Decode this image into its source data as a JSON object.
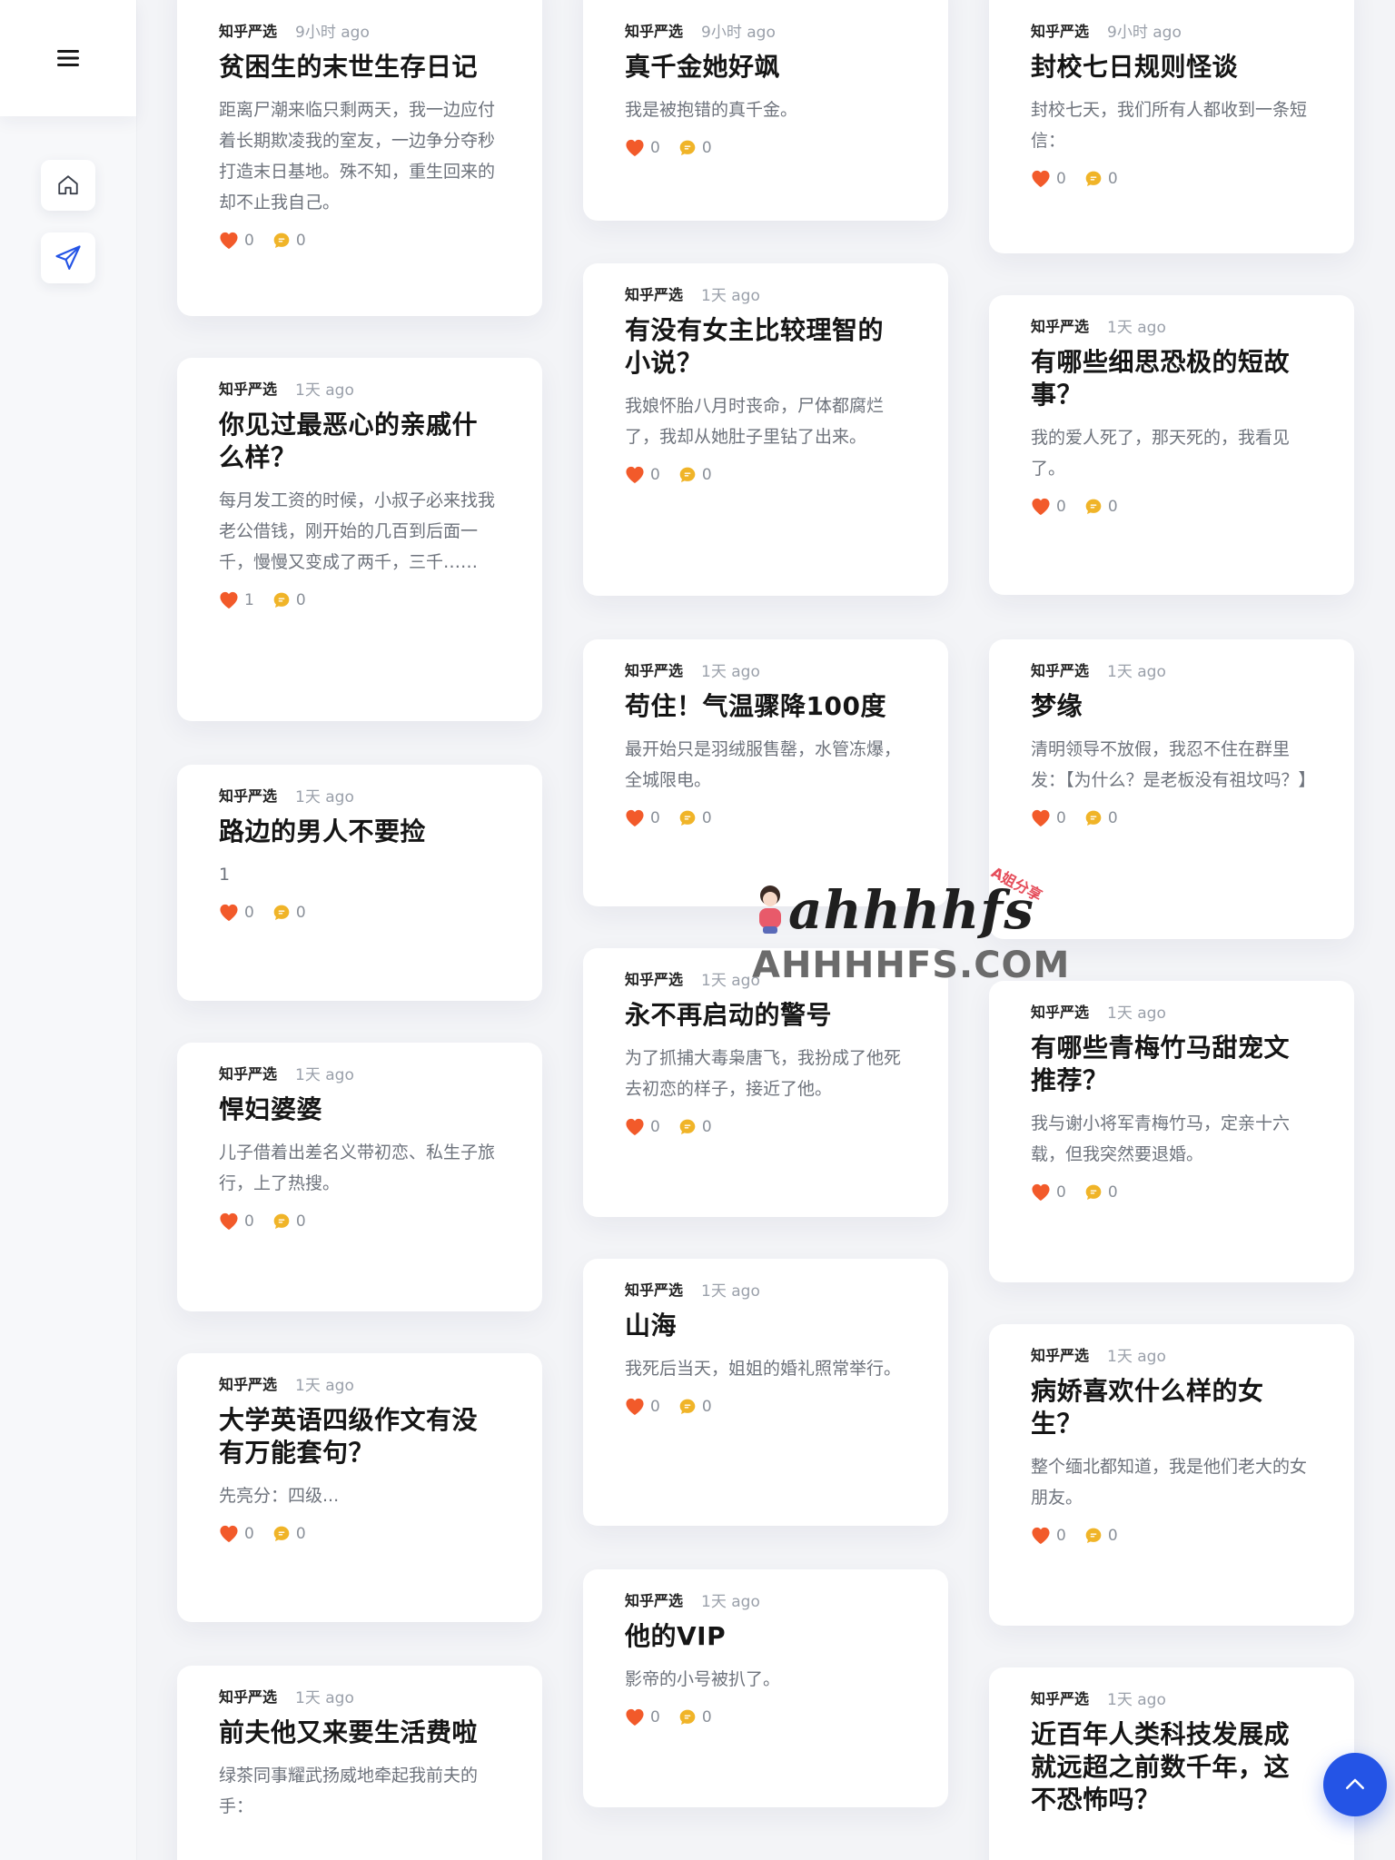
{
  "sidebar": {
    "menu_icon": "hamburger-menu-icon",
    "home_icon": "home-icon",
    "send_icon": "paper-plane-icon"
  },
  "colors": {
    "accent": "#2454e6",
    "heart": "#f25a2a",
    "comment": "#f0b428"
  },
  "columns": [
    [
      {
        "source": "知乎严选",
        "time": "9小时 ago",
        "title": "贫困生的末世生存日记",
        "excerpt": "距离尸潮来临只剩两天，我一边应付着长期欺凌我的室友，一边争分夺秒打造末日基地。殊不知，重生回来的却不止我自己。",
        "likes": "0",
        "comments": "0"
      },
      {
        "source": "知乎严选",
        "time": "1天 ago",
        "title": "你见过最恶心的亲戚什么样？",
        "excerpt": "每月发工资的时候，小叔子必来找我老公借钱，刚开始的几百到后面一千，慢慢又变成了两千，三千……",
        "likes": "1",
        "comments": "0"
      },
      {
        "source": "知乎严选",
        "time": "1天 ago",
        "title": "路边的男人不要捡",
        "excerpt": "1",
        "likes": "0",
        "comments": "0"
      },
      {
        "source": "知乎严选",
        "time": "1天 ago",
        "title": "悍妇婆婆",
        "excerpt": "儿子借着出差名义带初恋、私生子旅行，上了热搜。",
        "likes": "0",
        "comments": "0"
      },
      {
        "source": "知乎严选",
        "time": "1天 ago",
        "title": "大学英语四级作文有没有万能套句？",
        "excerpt": "先亮分：四级...",
        "likes": "0",
        "comments": "0"
      },
      {
        "source": "知乎严选",
        "time": "1天 ago",
        "title": "前夫他又来要生活费啦",
        "excerpt": "绿茶同事耀武扬威地牵起我前夫的手：",
        "likes": "",
        "comments": ""
      }
    ],
    [
      {
        "source": "知乎严选",
        "time": "9小时 ago",
        "title": "真千金她好飒",
        "excerpt": "我是被抱错的真千金。",
        "likes": "0",
        "comments": "0"
      },
      {
        "source": "知乎严选",
        "time": "1天 ago",
        "title": "有没有女主比较理智的小说？",
        "excerpt": "我娘怀胎八月时丧命，尸体都腐烂了，我却从她肚子里钻了出来。",
        "likes": "0",
        "comments": "0"
      },
      {
        "source": "知乎严选",
        "time": "1天 ago",
        "title": "苟住！气温骤降100度",
        "excerpt": "最开始只是羽绒服售罄，水管冻爆，全城限电。",
        "likes": "0",
        "comments": "0"
      },
      {
        "source": "知乎严选",
        "time": "1天 ago",
        "title": "永不再启动的警号",
        "excerpt": "为了抓捕大毒枭唐飞，我扮成了他死去初恋的样子，接近了他。",
        "likes": "0",
        "comments": "0"
      },
      {
        "source": "知乎严选",
        "time": "1天 ago",
        "title": "山海",
        "excerpt": "我死后当天，姐姐的婚礼照常举行。",
        "likes": "0",
        "comments": "0"
      },
      {
        "source": "知乎严选",
        "time": "1天 ago",
        "title": "他的VIP",
        "excerpt": "影帝的小号被扒了。",
        "likes": "0",
        "comments": "0"
      }
    ],
    [
      {
        "source": "知乎严选",
        "time": "9小时 ago",
        "title": "封校七日规则怪谈",
        "excerpt": "封校七天，我们所有人都收到一条短信：",
        "likes": "0",
        "comments": "0"
      },
      {
        "source": "知乎严选",
        "time": "1天 ago",
        "title": "有哪些细思恐极的短故事？",
        "excerpt": "我的爱人死了，那天死的，我看见了。",
        "likes": "0",
        "comments": "0"
      },
      {
        "source": "知乎严选",
        "time": "1天 ago",
        "title": "梦缘",
        "excerpt": "清明领导不放假，我忍不住在群里发：【为什么？是老板没有祖坟吗？】",
        "likes": "0",
        "comments": "0"
      },
      {
        "source": "知乎严选",
        "time": "1天 ago",
        "title": "有哪些青梅竹马甜宠文推荐？",
        "excerpt": "我与谢小将军青梅竹马，定亲十六载，但我突然要退婚。",
        "likes": "0",
        "comments": "0"
      },
      {
        "source": "知乎严选",
        "time": "1天 ago",
        "title": "病娇喜欢什么样的女生？",
        "excerpt": "整个缅北都知道，我是他们老大的女朋友。",
        "likes": "0",
        "comments": "0"
      },
      {
        "source": "知乎严选",
        "time": "1天 ago",
        "title": "近百年人类科技发展成就远超之前数千年，这不恐怖吗？",
        "excerpt": "",
        "likes": "",
        "comments": ""
      }
    ]
  ],
  "watermark": {
    "logo": "ahhhhfs",
    "badge": "A姐分享",
    "domain": "AHHHHFS.COM"
  },
  "back_to_top_icon": "chevron-up-icon"
}
